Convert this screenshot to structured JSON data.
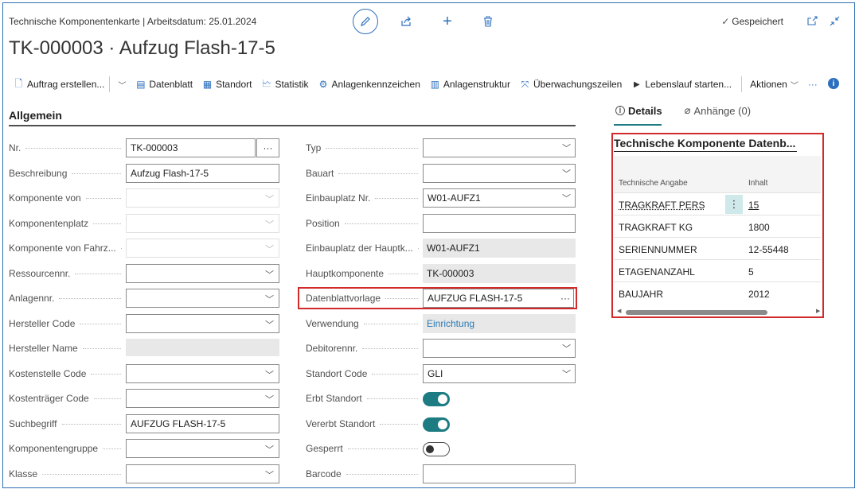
{
  "header": {
    "subtitle": "Technische Komponentenkarte | Arbeitsdatum: 25.01.2024",
    "title": "TK-000003 · Aufzug Flash-17-5",
    "saved_label": "Gespeichert"
  },
  "actions": {
    "auftrag": "Auftrag erstellen...",
    "datenblatt": "Datenblatt",
    "standort": "Standort",
    "statistik": "Statistik",
    "anlagenkennzeichen": "Anlagenkennzeichen",
    "anlagenstruktur": "Anlagenstruktur",
    "ueberwachung": "Überwachungszeilen",
    "lebenslauf": "Lebenslauf starten...",
    "aktionen": "Aktionen",
    "more": "···"
  },
  "section": {
    "title": "Allgemein"
  },
  "left_fields": [
    {
      "label": "Nr.",
      "value": "TK-000003"
    },
    {
      "label": "Beschreibung",
      "value": "Aufzug Flash-17-5"
    },
    {
      "label": "Komponente von",
      "value": ""
    },
    {
      "label": "Komponentenplatz",
      "value": ""
    },
    {
      "label": "Komponente von Fahrz...",
      "value": ""
    },
    {
      "label": "Ressourcennr.",
      "value": ""
    },
    {
      "label": "Anlagennr.",
      "value": ""
    },
    {
      "label": "Hersteller Code",
      "value": ""
    },
    {
      "label": "Hersteller Name",
      "value": ""
    },
    {
      "label": "Kostenstelle Code",
      "value": ""
    },
    {
      "label": "Kostenträger Code",
      "value": ""
    },
    {
      "label": "Suchbegriff",
      "value": "AUFZUG FLASH-17-5"
    },
    {
      "label": "Komponentengruppe",
      "value": ""
    },
    {
      "label": "Klasse",
      "value": ""
    }
  ],
  "right_fields": [
    {
      "label": "Typ",
      "value": ""
    },
    {
      "label": "Bauart",
      "value": ""
    },
    {
      "label": "Einbauplatz Nr.",
      "value": "W01-AUFZ1"
    },
    {
      "label": "Position",
      "value": ""
    },
    {
      "label": "Einbauplatz der Hauptk...",
      "value": "W01-AUFZ1"
    },
    {
      "label": "Hauptkomponente",
      "value": "TK-000003"
    },
    {
      "label": "Datenblattvorlage",
      "value": "AUFZUG FLASH-17-5"
    },
    {
      "label": "Verwendung",
      "value": "Einrichtung"
    },
    {
      "label": "Debitorennr.",
      "value": ""
    },
    {
      "label": "Standort Code",
      "value": "GLI"
    },
    {
      "label": "Erbt Standort",
      "value": "on"
    },
    {
      "label": "Vererbt Standort",
      "value": "on"
    },
    {
      "label": "Gesperrt",
      "value": "off"
    },
    {
      "label": "Barcode",
      "value": ""
    }
  ],
  "factbox": {
    "tab_details": "Details",
    "tab_attachments": "Anhänge (0)",
    "title": "Technische Komponente Datenb...",
    "col_key": "Technische Angabe",
    "col_value": "Inhalt",
    "rows": [
      {
        "key": "TRAGKRAFT PERS",
        "value": "15"
      },
      {
        "key": "TRAGKRAFT KG",
        "value": "1800"
      },
      {
        "key": "SERIENNUMMER",
        "value": "12-55448"
      },
      {
        "key": "ETAGENANZAHL",
        "value": "5"
      },
      {
        "key": "BAUJAHR",
        "value": "2012"
      }
    ]
  },
  "colors": {
    "accent": "#1d7b82",
    "link": "#2a7ab5",
    "highlight": "#d02a2a",
    "icon": "#2c6fbe"
  },
  "icons": [
    "pencil-icon",
    "share-icon",
    "plus-icon",
    "trash-icon",
    "check-icon",
    "popout-icon",
    "collapse-icon",
    "info-icon"
  ]
}
